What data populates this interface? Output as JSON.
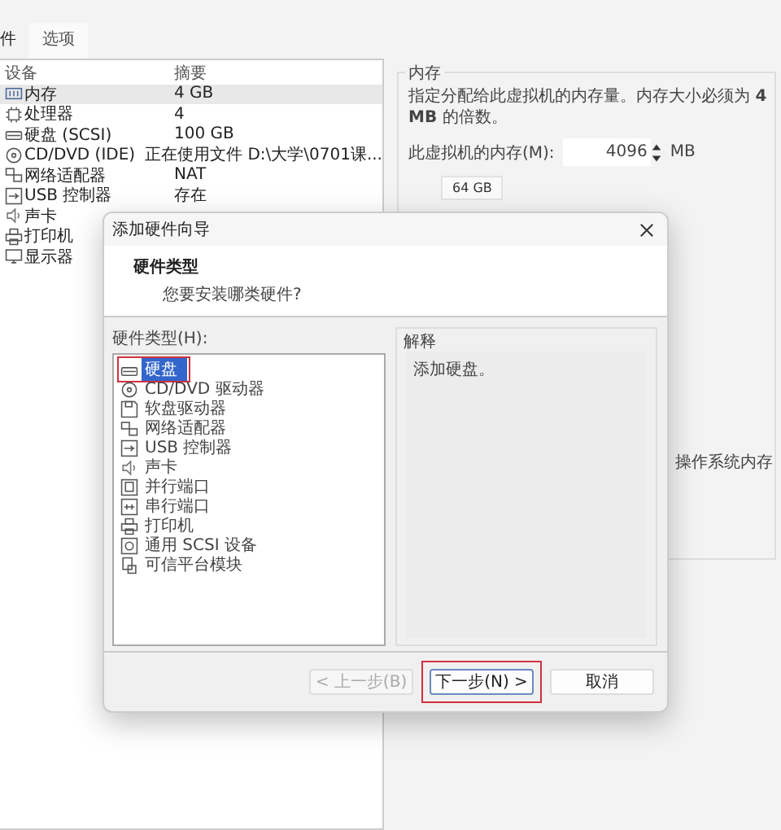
{
  "tabs": [
    {
      "label": "件",
      "selected": true
    },
    {
      "label": "选项",
      "selected": false
    }
  ],
  "device_table": {
    "columns": [
      "设备",
      "摘要"
    ],
    "rows": [
      {
        "kind": "memory",
        "device": "内存",
        "summary": "4 GB",
        "selected": true
      },
      {
        "kind": "cpu",
        "device": "处理器",
        "summary": "4",
        "selected": false
      },
      {
        "kind": "disk",
        "device": "硬盘 (SCSI)",
        "summary": "100 GB",
        "selected": false
      },
      {
        "kind": "cd",
        "device": "CD/DVD (IDE)",
        "summary": "正在使用文件 D:\\大学\\0701课...",
        "selected": false
      },
      {
        "kind": "network",
        "device": "网络适配器",
        "summary": "NAT",
        "selected": false
      },
      {
        "kind": "usb",
        "device": "USB 控制器",
        "summary": "存在",
        "selected": false
      },
      {
        "kind": "sound",
        "device": "声卡",
        "summary": "",
        "selected": false
      },
      {
        "kind": "printer",
        "device": "打印机",
        "summary": "",
        "selected": false
      },
      {
        "kind": "display",
        "device": "显示器",
        "summary": "",
        "selected": false
      }
    ]
  },
  "memory_panel": {
    "title": "内存",
    "description": "指定分配给此虚拟机的内存量。内存大小必须为 **4 MB** 的倍数。",
    "field_label": "此虚拟机的内存(M):",
    "value": "4096",
    "unit": "MB",
    "scale_label": "64 GB",
    "side_note": "操作系统内存"
  },
  "dialog": {
    "title": "添加硬件向导",
    "heading": "硬件类型",
    "subheading": "您要安装哪类硬件?",
    "list_label": "硬件类型(H):",
    "items": [
      {
        "kind": "disk",
        "label": "硬盘",
        "selected": true,
        "annotated": true
      },
      {
        "kind": "cd",
        "label": "CD/DVD 驱动器",
        "selected": false,
        "annotated": false
      },
      {
        "kind": "floppy",
        "label": "软盘驱动器",
        "selected": false,
        "annotated": false
      },
      {
        "kind": "network",
        "label": "网络适配器",
        "selected": false,
        "annotated": false
      },
      {
        "kind": "usb",
        "label": "USB 控制器",
        "selected": false,
        "annotated": false
      },
      {
        "kind": "sound",
        "label": "声卡",
        "selected": false,
        "annotated": false
      },
      {
        "kind": "parallel",
        "label": "并行端口",
        "selected": false,
        "annotated": false
      },
      {
        "kind": "serial",
        "label": "串行端口",
        "selected": false,
        "annotated": false
      },
      {
        "kind": "printer",
        "label": "打印机",
        "selected": false,
        "annotated": false
      },
      {
        "kind": "scsi",
        "label": "通用 SCSI 设备",
        "selected": false,
        "annotated": false
      },
      {
        "kind": "tpm",
        "label": "可信平台模块",
        "selected": false,
        "annotated": false
      }
    ],
    "explanation_title": "解释",
    "explanation": "添加硬盘。",
    "buttons": [
      {
        "label": "< 上一步(B)",
        "disabled": true,
        "annotated": false
      },
      {
        "label": "下一步(N) >",
        "disabled": false,
        "annotated": true
      },
      {
        "label": "取消",
        "disabled": false,
        "annotated": false
      }
    ]
  }
}
